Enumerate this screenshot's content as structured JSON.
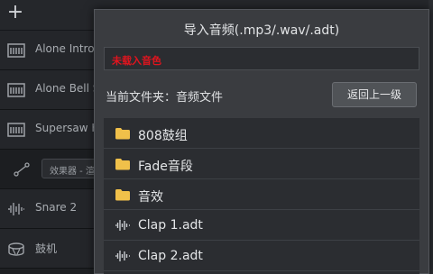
{
  "background": {
    "plus_label": "+",
    "tracks": [
      {
        "name": "Alone Intro",
        "icon": "synth-icon"
      },
      {
        "name": "Alone Bell S",
        "icon": "synth-icon"
      },
      {
        "name": "Supersaw H",
        "icon": "synth-icon"
      },
      {
        "name": "效果器 - 渲",
        "icon": "fx-node-icon"
      },
      {
        "name": "Snare 2",
        "icon": "waveform-icon"
      },
      {
        "name": "鼓机",
        "icon": "drum-icon"
      }
    ]
  },
  "dialog": {
    "title": "导入音频(.mp3/.wav/.adt)",
    "status": "未载入音色",
    "current_folder": "当前文件夹：音频文件",
    "back_button": "返回上一级",
    "files": [
      {
        "name": "808鼓组",
        "type": "folder"
      },
      {
        "name": "Fade音段",
        "type": "folder"
      },
      {
        "name": "音效",
        "type": "folder"
      },
      {
        "name": "Clap 1.adt",
        "type": "audio"
      },
      {
        "name": "Clap 2.adt",
        "type": "audio"
      }
    ]
  },
  "colors": {
    "status_text": "#e1141e",
    "folder_icon": "#f0c04a",
    "dialog_bg": "#3a3c40",
    "list_bg": "#2b2d31"
  }
}
